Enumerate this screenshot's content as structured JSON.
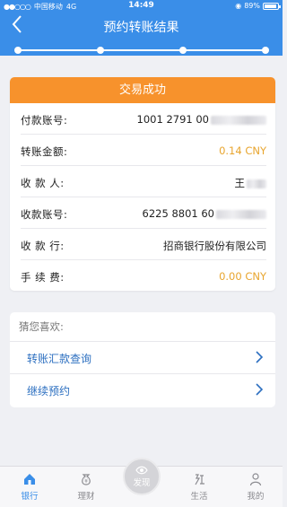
{
  "status_bar": {
    "carrier": "中国移动",
    "network": "4G",
    "time": "14:49",
    "battery": "89%"
  },
  "header": {
    "title": "预约转账结果",
    "progress_steps": 4
  },
  "result": {
    "banner": "交易成功",
    "rows": [
      {
        "label": "付款账号:",
        "value": "1001 2791 00",
        "masked": true
      },
      {
        "label": "转账金额:",
        "value": "0.14 CNY",
        "masked": false,
        "highlight": true
      },
      {
        "label": "收 款 人:",
        "value": "王",
        "masked": true
      },
      {
        "label": "收款账号:",
        "value": "6225 8801 60",
        "masked": true
      },
      {
        "label": "收 款 行:",
        "value": "招商银行股份有限公司",
        "masked": false
      },
      {
        "label": "手 续 费:",
        "value": "0.00 CNY",
        "masked": false,
        "highlight": true
      }
    ]
  },
  "suggestions": {
    "title": "猜您喜欢:",
    "items": [
      {
        "label": "转账汇款查询"
      },
      {
        "label": "继续预约"
      }
    ]
  },
  "tabs": [
    {
      "label": "银行",
      "icon": "home-icon",
      "active": true
    },
    {
      "label": "理财",
      "icon": "money-bag-icon",
      "active": false
    },
    {
      "label": "发现",
      "icon": "eye-icon",
      "active": false
    },
    {
      "label": "生活",
      "icon": "life-icon",
      "active": false
    },
    {
      "label": "我的",
      "icon": "person-icon",
      "active": false
    }
  ],
  "colors": {
    "primary": "#3a8ee8",
    "banner": "#f7922c",
    "amount": "#e8a52e",
    "link": "#2c6fc0"
  }
}
